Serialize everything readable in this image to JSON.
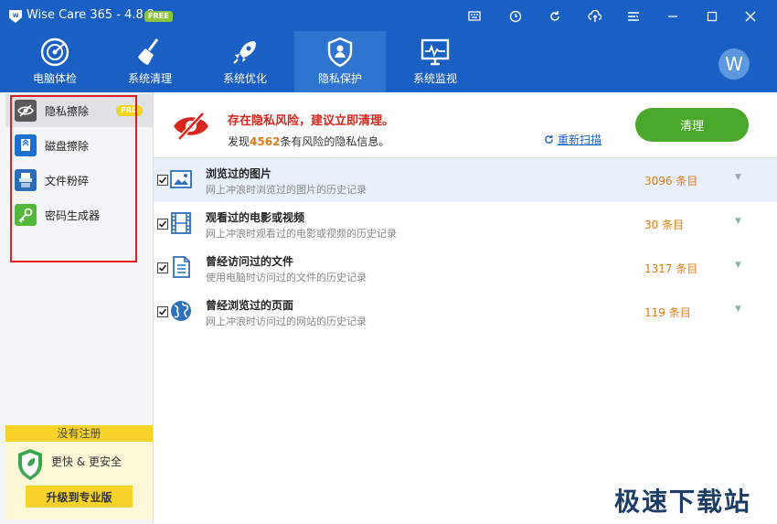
{
  "titlebar": {
    "title": "Wise Care 365 - 4.8.2",
    "badge": "FREE"
  },
  "nav": {
    "tabs": [
      {
        "label": "电脑体检",
        "icon": "radar-icon"
      },
      {
        "label": "系统清理",
        "icon": "broom-icon"
      },
      {
        "label": "系统优化",
        "icon": "rocket-icon"
      },
      {
        "label": "隐私保护",
        "icon": "privacy-shield-icon"
      },
      {
        "label": "系统监视",
        "icon": "monitor-icon"
      }
    ],
    "avatar": "W"
  },
  "sidebar": {
    "items": [
      {
        "label": "隐私擦除",
        "badge": "PRO"
      },
      {
        "label": "磁盘擦除"
      },
      {
        "label": "文件粉碎"
      },
      {
        "label": "密码生成器"
      }
    ],
    "promo": {
      "title": "没有注册",
      "text": "更快 & 更安全",
      "button": "升级到专业版"
    }
  },
  "alert": {
    "title": "存在隐私风险，建议立即清理。",
    "prefix": "发现",
    "count": "4562",
    "suffix": "条有风险的隐私信息。",
    "rescan": "重新扫描",
    "clean": "清理"
  },
  "rows": [
    {
      "title": "浏览过的图片",
      "desc": "网上冲浪时浏览过的图片的历史记录",
      "count": "3096 条目"
    },
    {
      "title": "观看过的电影或视频",
      "desc": "网上冲浪时观看过的电影或视频的历史记录",
      "count": "30 条目"
    },
    {
      "title": "曾经访问过的文件",
      "desc": "使用电脑时访问过的文件的历史记录",
      "count": "1317 条目"
    },
    {
      "title": "曾经浏览过的页面",
      "desc": "网上冲浪时访问过的网站的历史记录",
      "count": "119 条目"
    }
  ],
  "watermark": "极速下载站",
  "colors": {
    "header": "#1a5fc4",
    "accent_green": "#4aa82b",
    "alert_red": "#d9261c",
    "count_orange": "#e17c14",
    "promo_yellow": "#f6d326"
  }
}
